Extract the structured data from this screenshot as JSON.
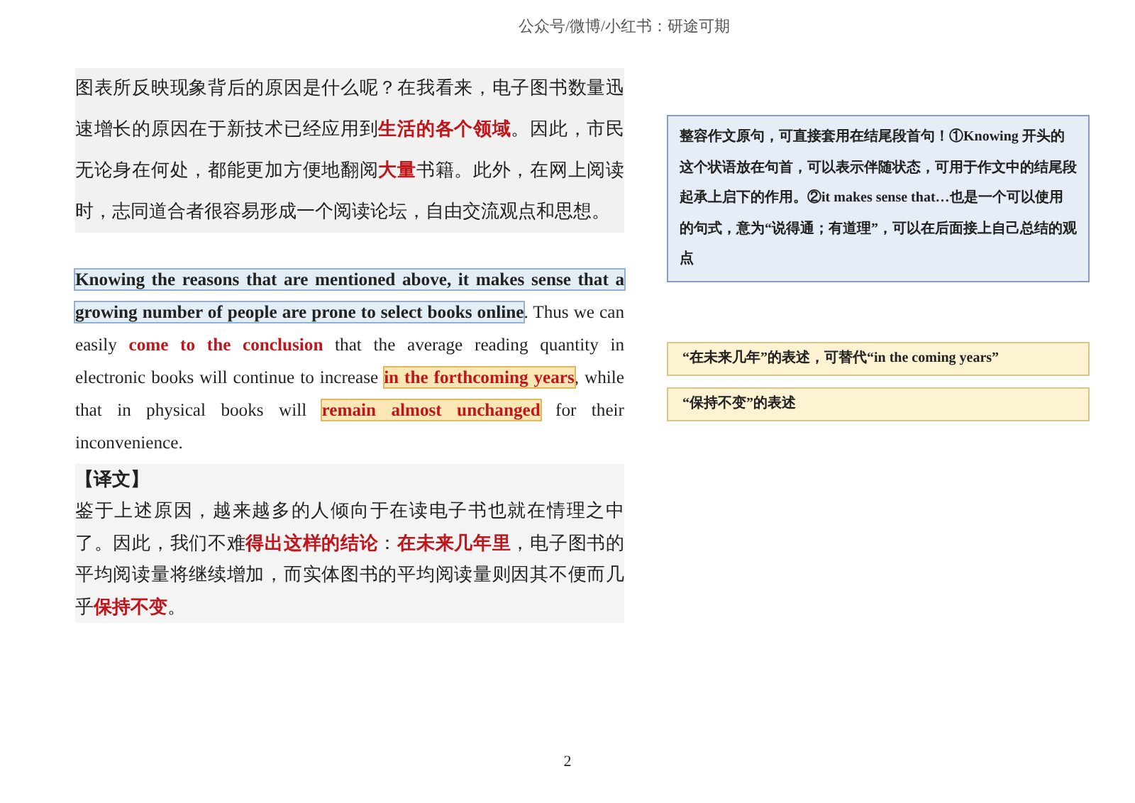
{
  "header": "公众号/微博/小红书：研途可期",
  "paragraphs": [
    {
      "shaded": true,
      "segments": [
        {
          "kind": "plain",
          "text": "图表所反映现象背后的原因是什么呢？在我看来，电子图书数量迅速增长的原因在于新技术已经应用到"
        },
        {
          "kind": "emphasis",
          "text": "生活的各个领域"
        },
        {
          "kind": "plain",
          "text": "。因此，市民无论身在何处，都能更加方便地翻阅"
        },
        {
          "kind": "emphasis",
          "text": "大量"
        },
        {
          "kind": "plain",
          "text": "书籍。此外，在网上阅读时，志同道合者很容易形成一个阅读论坛，自由交流观点和思想。"
        }
      ]
    },
    {
      "shaded": false,
      "segments": [
        {
          "kind": "key-sentence",
          "text": "Knowing the reasons that are mentioned above, it makes sense that a growing number of people are prone to select books online"
        },
        {
          "kind": "plain",
          "text": ". Thus we can easily "
        },
        {
          "kind": "emphasis",
          "text": "come to the conclusion"
        },
        {
          "kind": "plain",
          "text": " that the average reading quantity in electronic books will continue to increase "
        },
        {
          "kind": "key-phrase",
          "text": "in the forthcoming years"
        },
        {
          "kind": "plain",
          "text": ", while that in physical books will "
        },
        {
          "kind": "key-phrase",
          "text": "remain almost unchanged"
        },
        {
          "kind": "plain",
          "text": " for their inconvenience."
        }
      ]
    }
  ],
  "translation": {
    "heading": "【译文】",
    "segments": [
      {
        "kind": "plain",
        "text": "鉴于上述原因，越来越多的人倾向于在读电子书也就在情理之中了。因此，我们不难"
      },
      {
        "kind": "emphasis",
        "text": "得出这样的结论"
      },
      {
        "kind": "plain",
        "text": "："
      },
      {
        "kind": "emphasis",
        "text": "在未来几年里"
      },
      {
        "kind": "plain",
        "text": "，电子图书的平均阅读量将继续增加，而实体图书的平均阅读量则因其不便而几乎"
      },
      {
        "kind": "emphasis",
        "text": "保持不变"
      },
      {
        "kind": "plain",
        "text": "。"
      }
    ]
  },
  "notes": [
    {
      "kind": "sentence-note",
      "text": "整容作文原句，可直接套用在结尾段首句！①Knowing 开头的这个状语放在句首，可以表示伴随状态，可用于作文中的结尾段起承上启下的作用。②it makes sense that…也是一个可以使用的句式，意为“说得通；有道理”，可以在后面接上自己总结的观点"
    },
    {
      "kind": "phrase-note",
      "text": "“在未来几年”的表述，可替代“in the coming years”"
    },
    {
      "kind": "phrase-note",
      "text": "“保持不变”的表述"
    }
  ],
  "page_number": "2"
}
